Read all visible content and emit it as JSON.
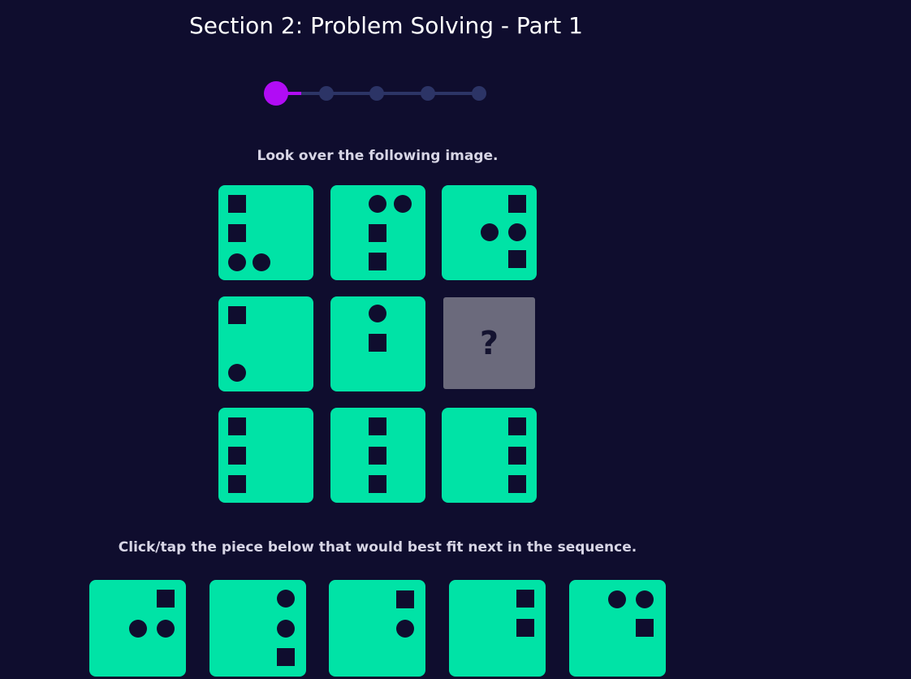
{
  "header": {
    "title": "Section 2: Problem Solving - Part 1"
  },
  "progress": {
    "current_step": 1,
    "total_steps": 5
  },
  "instructions": {
    "look": "Look over the following image.",
    "choose": "Click/tap the piece below that would best fit next in the sequence."
  },
  "puzzle": {
    "missing_label": "?"
  },
  "colors": {
    "background": "#0f0d2e",
    "tile": "#00e3a6",
    "missing_tile": "#6b6a7c",
    "progress_active": "#b10cf5",
    "progress_inactive": "#2c3466"
  }
}
